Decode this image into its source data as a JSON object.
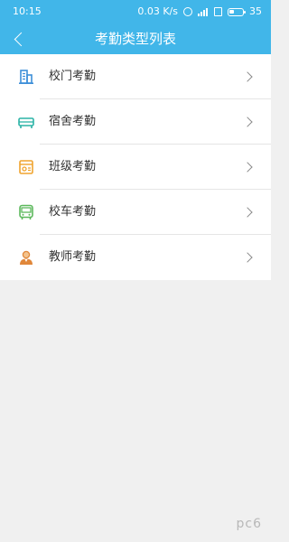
{
  "status_bar": {
    "time": "10:15",
    "net_speed": "0.03 K/s",
    "battery": "35",
    "battery_level": 0.35
  },
  "header": {
    "title": "考勤类型列表"
  },
  "list": {
    "items": [
      {
        "label": "校门考勤",
        "icon": "building-icon",
        "color": "#3d8fd9"
      },
      {
        "label": "宿舍考勤",
        "icon": "bed-icon",
        "color": "#2bb3a6"
      },
      {
        "label": "班级考勤",
        "icon": "classroom-icon",
        "color": "#f0a42e"
      },
      {
        "label": "校车考勤",
        "icon": "bus-icon",
        "color": "#5cb85c"
      },
      {
        "label": "教师考勤",
        "icon": "teacher-icon",
        "color": "#e0873a"
      }
    ]
  },
  "watermark": "pc6"
}
